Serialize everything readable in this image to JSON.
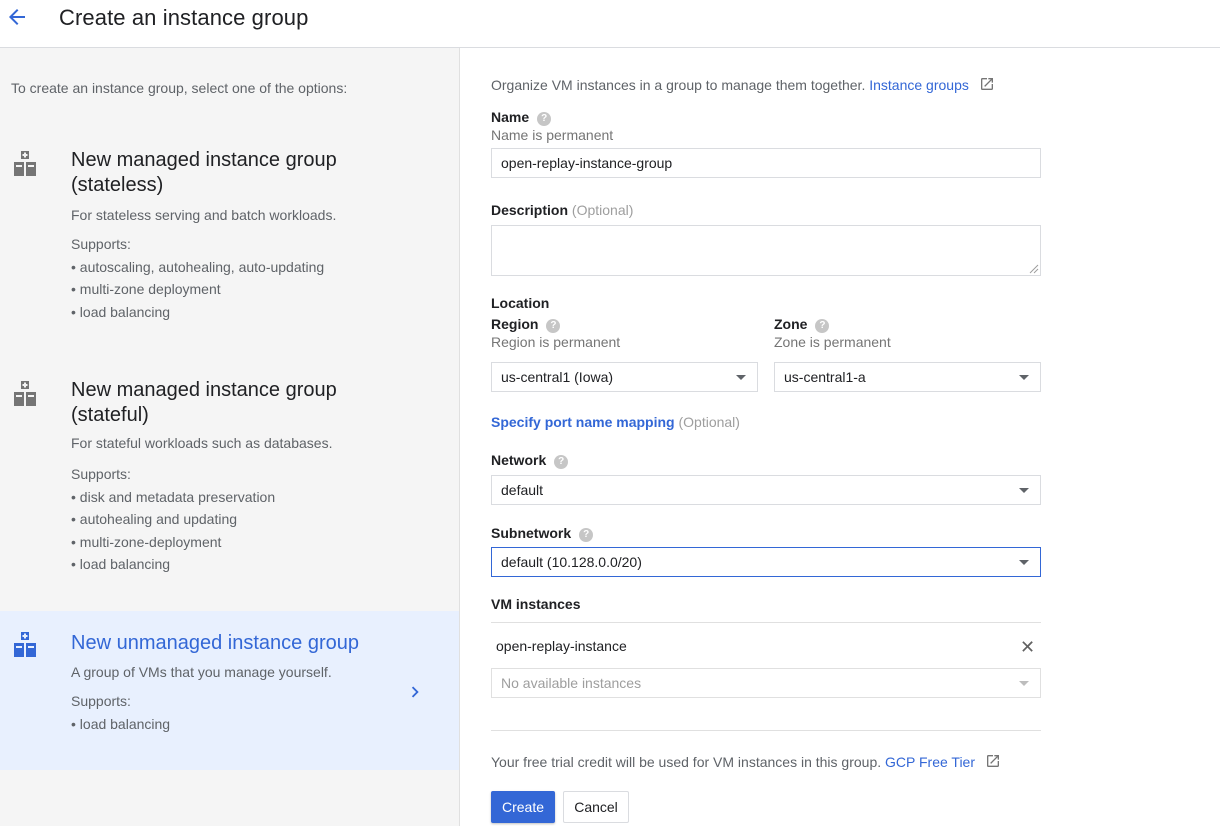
{
  "header": {
    "title": "Create an instance group",
    "back_icon": "arrow-back-icon"
  },
  "left": {
    "intro": "To create an instance group, select one of the options:",
    "options": [
      {
        "title_line1": "New managed instance group",
        "title_line2": "(stateless)",
        "description": "For stateless serving and batch workloads.",
        "supports_label": "Supports:",
        "supports": [
          "• autoscaling, autohealing, auto-updating",
          "• multi-zone deployment",
          "• load balancing"
        ],
        "selected": false
      },
      {
        "title_line1": "New managed instance group",
        "title_line2": "(stateful)",
        "description": "For stateful workloads such as databases.",
        "supports_label": "Supports:",
        "supports": [
          "• disk and metadata preservation",
          "• autohealing and updating",
          "• multi-zone-deployment",
          "• load balancing"
        ],
        "selected": false
      },
      {
        "title_line1": "New unmanaged instance group",
        "description": "A group of VMs that you manage yourself.",
        "supports_label": "Supports:",
        "supports": [
          "• load balancing"
        ],
        "selected": true
      }
    ]
  },
  "form": {
    "intro_text": "Organize VM instances in a group to manage them together.",
    "intro_link": "Instance groups",
    "name": {
      "label": "Name",
      "hint": "Name is permanent",
      "value": "open-replay-instance-group"
    },
    "description": {
      "label": "Description",
      "optional": "(Optional)",
      "value": ""
    },
    "location": {
      "label": "Location",
      "region": {
        "label": "Region",
        "hint": "Region is permanent",
        "value": "us-central1 (Iowa)"
      },
      "zone": {
        "label": "Zone",
        "hint": "Zone is permanent",
        "value": "us-central1-a"
      }
    },
    "port_mapping": {
      "link": "Specify port name mapping",
      "optional": "(Optional)"
    },
    "network": {
      "label": "Network",
      "value": "default"
    },
    "subnetwork": {
      "label": "Subnetwork",
      "value": "default (10.128.0.0/20)"
    },
    "vm_instances": {
      "label": "VM instances",
      "items": [
        "open-replay-instance"
      ],
      "remove_glyph": "✕",
      "add_placeholder": "No available instances"
    },
    "free_tier": {
      "text": "Your free trial credit will be used for VM instances in this group.",
      "link": "GCP Free Tier"
    },
    "buttons": {
      "create": "Create",
      "cancel": "Cancel"
    }
  },
  "colors": {
    "accent": "#3367d6",
    "selected_bg": "#e8f0fe",
    "panel_bg": "#f5f5f5"
  }
}
